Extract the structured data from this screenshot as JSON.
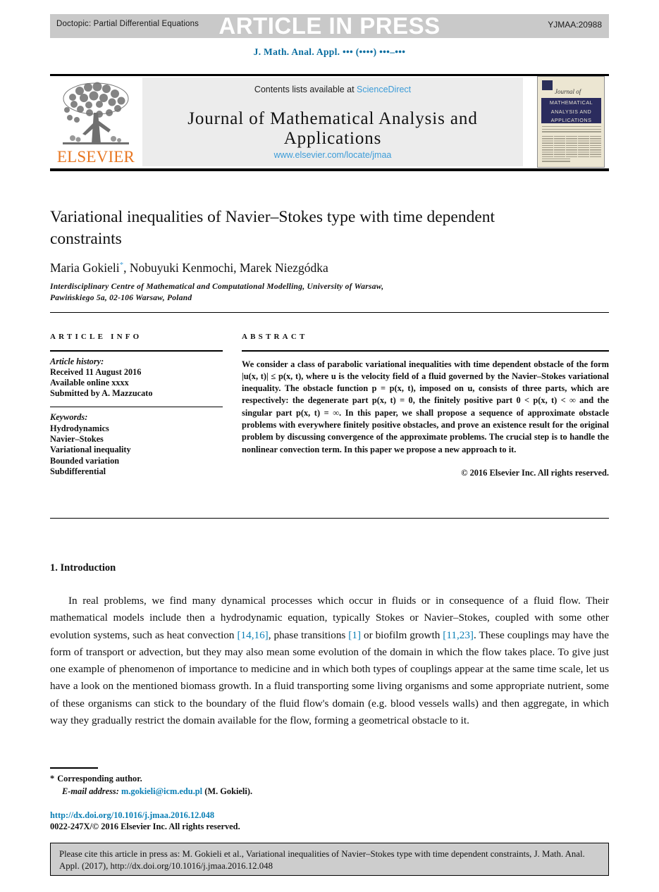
{
  "header": {
    "doctopic": "Doctopic: Partial Differential Equations",
    "article_in_press": "ARTICLE IN PRESS",
    "pii": "YJMAA:20988",
    "journal_ref": "J. Math. Anal. Appl. ••• (••••) •••–•••"
  },
  "masthead": {
    "contents_prefix": "Contents lists available at ",
    "sciencedirect": "ScienceDirect",
    "journal_name": "Journal of Mathematical Analysis and Applications",
    "journal_url": "www.elsevier.com/locate/jmaa",
    "publisher": "ELSEVIER",
    "cover": {
      "journal_of": "Journal of",
      "band_line1": "MATHEMATICAL",
      "band_line2": "ANALYSIS AND",
      "band_line3": "APPLICATIONS"
    }
  },
  "article": {
    "title": "Variational inequalities of Navier–Stokes type with time dependent constraints",
    "authors_pre": "Maria Gokieli",
    "authors_marker": "*",
    "authors_post": ", Nobuyuki Kenmochi, Marek Niezgódka",
    "affiliation_line1": "Interdisciplinary Centre of Mathematical and Computational Modelling, University of Warsaw,",
    "affiliation_line2": "Pawińskiego 5a, 02-106 Warsaw, Poland"
  },
  "info": {
    "heading": "ARTICLE INFO",
    "history_label": "Article history:",
    "history_items": [
      "Received 11 August 2016",
      "Available online xxxx",
      "Submitted by A. Mazzucato"
    ],
    "keywords_label": "Keywords:",
    "keywords": [
      "Hydrodynamics",
      "Navier–Stokes",
      "Variational inequality",
      "Bounded variation",
      "Subdifferential"
    ]
  },
  "abstract": {
    "heading": "ABSTRACT",
    "text": "We consider a class of parabolic variational inequalities with time dependent obstacle of the form |u(x, t)| ≤ p(x, t), where u is the velocity field of a fluid governed by the Navier–Stokes variational inequality. The obstacle function p = p(x, t), imposed on u, consists of three parts, which are respectively: the degenerate part p(x, t) = 0, the finitely positive part 0 < p(x, t) < ∞ and the singular part p(x, t) = ∞. In this paper, we shall propose a sequence of approximate obstacle problems with everywhere finitely positive obstacles, and prove an existence result for the original problem by discussing convergence of the approximate problems. The crucial step is to handle the nonlinear convection term. In this paper we propose a new approach to it.",
    "copyright": "© 2016 Elsevier Inc. All rights reserved."
  },
  "body": {
    "section_title": "1. Introduction",
    "paragraph_part1": "In real problems, we find many dynamical processes which occur in fluids or in consequence of a fluid flow. Their mathematical models include then a hydrodynamic equation, typically Stokes or Navier–Stokes, coupled with some other evolution systems, such as heat convection ",
    "ref1": "[14,16]",
    "paragraph_part2": ", phase transitions ",
    "ref2": "[1]",
    "paragraph_part3": " or biofilm growth ",
    "ref3": "[11,23]",
    "paragraph_part4": ". These couplings may have the form of transport or advection, but they may also mean some evolution of the domain in which the flow takes place. To give just one example of phenomenon of importance to medicine and in which both types of couplings appear at the same time scale, let us have a look on the mentioned biomass growth. In a fluid transporting some living organisms and some appropriate nutrient, some of these organisms can stick to the boundary of the fluid flow's domain (e.g. blood vessels walls) and then aggregate, in which way they gradually restrict the domain available for the flow, forming a geometrical obstacle to it."
  },
  "footnotes": {
    "corresponding": "Corresponding author.",
    "corresponding_star": "*",
    "email_label": "E-mail address:",
    "email": "m.gokieli@icm.edu.pl",
    "email_suffix": "(M. Gokieli).",
    "doi": "http://dx.doi.org/10.1016/j.jmaa.2016.12.048",
    "issn": "0022-247X/© 2016 Elsevier Inc. All rights reserved."
  },
  "cite_box": {
    "text": "Please cite this article in press as: M. Gokieli et al., Variational inequalities of Navier–Stokes type with time dependent constraints, J. Math. Anal. Appl. (2017), http://dx.doi.org/10.1016/j.jmaa.2016.12.048"
  },
  "colors": {
    "link_blue": "#0b7fb5",
    "sciencedirect_blue": "#3c9cd8",
    "elsevier_orange": "#e87722",
    "header_gray": "#c9c9c9",
    "masthead_gray": "#ececec",
    "cite_gray": "#cdcdcd",
    "cover_navy": "#2b2c5e",
    "cover_cream": "#ece6d2"
  }
}
